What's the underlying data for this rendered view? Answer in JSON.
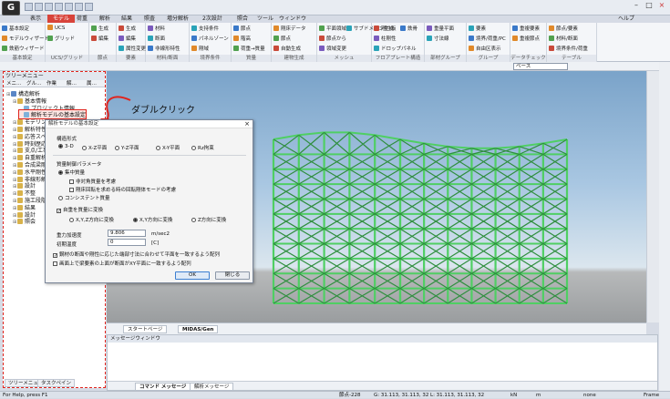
{
  "app": {
    "logo_letter": "G",
    "menu_tabs": [
      "表示",
      "モデル",
      "荷重",
      "解析",
      "結果",
      "照査",
      "増分解析",
      "2次設計",
      "照合",
      "ツール",
      "ウィンドウ"
    ],
    "active_tab_index": 1,
    "help_label": "ヘルプ",
    "accent_color": "#d8433a"
  },
  "ribbon": {
    "groups": [
      {
        "label": "基本設定",
        "items": [
          "基本設定",
          "モデルウィザード",
          "鉄筋ウィザード"
        ]
      },
      {
        "label": "UCS/グリッド",
        "items": [
          "UCS",
          "グリッド"
        ]
      },
      {
        "label": "節点",
        "items": [
          "生成",
          "編集"
        ]
      },
      {
        "label": "要素",
        "items": [
          "生成",
          "編集",
          "属性変更"
        ]
      },
      {
        "label": "材料/断面",
        "items": [
          "材料",
          "断面",
          "非線形特性"
        ]
      },
      {
        "label": "境界条件",
        "items": [
          "支持条件",
          "パネルゾーン",
          "剛域"
        ]
      },
      {
        "label": "質量",
        "items": [
          "節点",
          "階高",
          "荷重→質量"
        ]
      },
      {
        "label": "建物生成",
        "items": [
          "剛床データ",
          "節点",
          "自動生成"
        ]
      },
      {
        "label": "メッシュ",
        "items": [
          "平面領域",
          "節点から",
          "領域変更",
          "サブドメイン生成"
        ]
      },
      {
        "label": "フロアプレート構造",
        "items": [
          "剛性板",
          "柱剛性",
          "ドロップパネル",
          "鉄骨"
        ]
      },
      {
        "label": "部材グループ",
        "items": [
          "重量平面",
          "寸法線"
        ]
      },
      {
        "label": "グループ",
        "items": [
          "要素",
          "境界/荷重/PC",
          "自由区表示"
        ]
      },
      {
        "label": "データチェック",
        "items": [
          "重複要素",
          "重複節点"
        ]
      },
      {
        "label": "テーブル",
        "items": [
          "節点/要素",
          "材料/断面",
          "境界条件/荷重"
        ]
      }
    ]
  },
  "toolbar2": {
    "view_value": "ベース"
  },
  "tree": {
    "header": "ツリーメニュー",
    "tabs": [
      "メニ…",
      "グル…",
      "作業",
      "解…",
      "属…"
    ],
    "nodes": [
      {
        "label": "構造解析",
        "indent": 0
      },
      {
        "label": "基本情報",
        "indent": 1
      },
      {
        "label": "プロジェクト情報",
        "indent": 2
      },
      {
        "label": "解析モデルの基本設定",
        "indent": 2,
        "highlight": true
      },
      {
        "label": "モデリング",
        "indent": 1
      },
      {
        "label": "解析特性",
        "indent": 1
      },
      {
        "label": "応答スペクトル",
        "indent": 1
      },
      {
        "label": "時刻歴応答",
        "indent": 1
      },
      {
        "label": "支点/工事解析",
        "indent": 1
      },
      {
        "label": "自重解析",
        "indent": 1
      },
      {
        "label": "合成梁剛性",
        "indent": 1
      },
      {
        "label": "水平剛性率",
        "indent": 1
      },
      {
        "label": "非線形解析",
        "indent": 1
      },
      {
        "label": "設計",
        "indent": 1
      },
      {
        "label": "不整",
        "indent": 1
      },
      {
        "label": "施工段階解析",
        "indent": 1
      },
      {
        "label": "結果",
        "indent": 1
      },
      {
        "label": "設計",
        "indent": 1
      },
      {
        "label": "照会",
        "indent": 1
      }
    ],
    "bottom_tabs": [
      "ツリーメニュー",
      "タスクペイン"
    ]
  },
  "annotation": {
    "text": "ダブルクリック"
  },
  "dialog": {
    "title": "解析モデルの基本設定",
    "structure_label": "構造形式",
    "structure_options": [
      "3-D",
      "X-Z平面",
      "Y-Z平面",
      "X-Y平面",
      "Rz拘束"
    ],
    "structure_selected": 0,
    "mass_label": "質量制御パラメータ",
    "mass_options": [
      "集中質量",
      "コンシステント質量"
    ],
    "mass_selected": 0,
    "sub_checks": [
      "非対角質量を考慮",
      "剛床回転を求める時の回転剛体モードの考慮"
    ],
    "convert_label": "自重を質量に変換",
    "convert_options": [
      "X,Y,Z方向に変換",
      "X,Y方向に変換",
      "Z方向に変換"
    ],
    "convert_selected": 1,
    "gravity_label": "重力加速度",
    "gravity_value": "9.806",
    "gravity_unit": "m/sec2",
    "temp_label": "初期温度",
    "temp_value": "0",
    "temp_unit": "[C]",
    "option_checks": [
      "鋼材の断面や剛性に応じた端部寸法に合わせて平面を一致するよう配列",
      "画面上で梁要素の上面が断面がXY平面に一致するよう配列"
    ],
    "ok_label": "OK",
    "close_label": "閉じる"
  },
  "viewtabs": {
    "tabs": [
      "スタートページ",
      "MIDAS/Gen"
    ]
  },
  "message": {
    "header": "メッセージウィンドウ",
    "tabs": [
      "コマンド メッセージ",
      "解析メッセージ"
    ]
  },
  "statusbar": {
    "help": "For Help, press F1",
    "node": "節点-228",
    "coords1": "G: 31.113, 31.113, 32",
    "coords2": "L: 31.113, 31.113, 32",
    "unit_force": "kN",
    "unit_length": "m",
    "scale": "none",
    "frame": "Frame"
  },
  "colors": {
    "building": "#4fcf63",
    "building_dark": "#2f8f3e",
    "dialog_border": "#7a8699"
  }
}
